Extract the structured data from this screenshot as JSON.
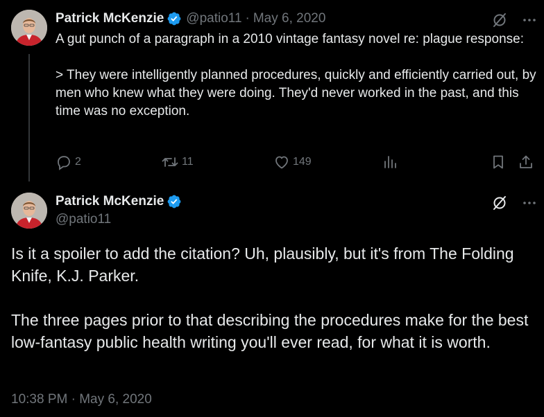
{
  "tweet1": {
    "author_name": "Patrick McKenzie",
    "handle": "@patio11",
    "separator": "·",
    "date": "May 6, 2020",
    "text": "A gut punch of a paragraph in a 2010 vintage fantasy novel re: plague response:\n\n> They were intelligently planned procedures, quickly and efficiently carried out, by men who knew what they were doing. They'd never worked in the past, and this time was no exception.",
    "replies": "2",
    "reposts": "11",
    "likes": "149"
  },
  "tweet2": {
    "author_name": "Patrick McKenzie",
    "handle": "@patio11",
    "text": "Is it a spoiler to add the citation? Uh, plausibly, but it's from The Folding Knife, K.J. Parker.\n\nThe three pages prior to that describing the procedures make for the best low-fantasy public health writing you'll ever read, for what it is worth.",
    "timestamp": "10:38 PM · May 6, 2020"
  },
  "icons": {
    "verified": "verified-badge-icon",
    "grok": "grok-icon",
    "more": "more-icon",
    "reply": "reply-icon",
    "repost": "repost-icon",
    "like": "like-icon",
    "views": "views-icon",
    "bookmark": "bookmark-icon",
    "share": "share-icon"
  },
  "colors": {
    "background": "#000000",
    "text": "#e7e9ea",
    "muted": "#71767b",
    "verified": "#1d9bf0"
  }
}
